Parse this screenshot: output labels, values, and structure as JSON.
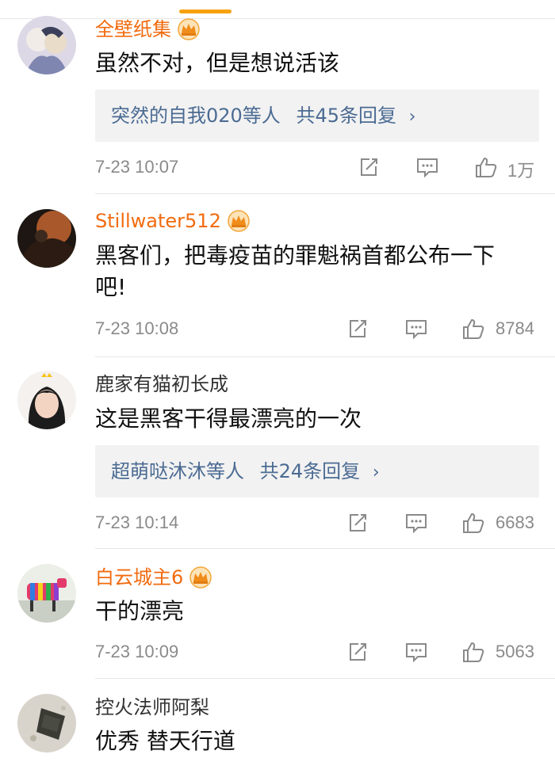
{
  "colors": {
    "vip_name": "#f26b0f",
    "normal_name": "#333333",
    "reply_link": "#4b6b93",
    "meta_gray": "#8a8a8a",
    "top_indicator": "#f7a20c"
  },
  "icons": {
    "share": "share-icon",
    "comment": "comment-icon",
    "like": "thumbs-up-icon",
    "vip": "crown-icon"
  },
  "comments": [
    {
      "username": "全壁纸集",
      "vip": true,
      "text": "虽然不对，但是想说活该",
      "replies": {
        "users": "突然的自我020等人",
        "count_text": "共45条回复"
      },
      "time": "7-23 10:07",
      "likes": "1万"
    },
    {
      "username": "Stillwater512",
      "vip": true,
      "text": "黑客们，把毒疫苗的罪魁祸首都公布一下吧!",
      "time": "7-23 10:08",
      "likes": "8784"
    },
    {
      "username": "鹿家有猫初长成",
      "vip": false,
      "text": "这是黑客干得最漂亮的一次",
      "replies": {
        "users": "超萌哒沐沐等人",
        "count_text": "共24条回复"
      },
      "time": "7-23 10:14",
      "likes": "6683"
    },
    {
      "username": "白云城主6",
      "vip": true,
      "text": "干的漂亮",
      "time": "7-23 10:09",
      "likes": "5063"
    },
    {
      "username": "控火法师阿梨",
      "vip": false,
      "text": "优秀 替天行道"
    }
  ]
}
